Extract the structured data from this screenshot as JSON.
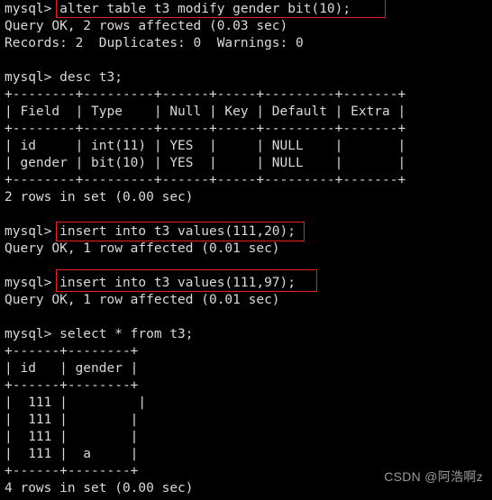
{
  "terminal": {
    "prompt": "mysql>",
    "background_color": "#000000",
    "text_color": "#d9d9d9",
    "highlight_color": "#e8201f",
    "lines": [
      "mysql> alter table t3 modify gender bit(10);",
      "Query OK, 2 rows affected (0.03 sec)",
      "Records: 2  Duplicates: 0  Warnings: 0",
      "",
      "mysql> desc t3;",
      "+--------+---------+------+-----+---------+-------+",
      "| Field  | Type    | Null | Key | Default | Extra |",
      "+--------+---------+------+-----+---------+-------+",
      "| id     | int(11) | YES  |     | NULL    |       |",
      "| gender | bit(10) | YES  |     | NULL    |       |",
      "+--------+---------+------+-----+---------+-------+",
      "2 rows in set (0.00 sec)",
      "",
      "mysql> insert into t3 values(111,20);",
      "Query OK, 1 row affected (0.01 sec)",
      "",
      "mysql> insert into t3 values(111,97);",
      "Query OK, 1 row affected (0.01 sec)",
      "",
      "mysql> select * from t3;",
      "+------+--------+",
      "| id   | gender |",
      "+------+--------+",
      "|  111 |         |",
      "|  111 |        |",
      "|  111 |        |",
      "|  111 |  a     |",
      "+------+--------+",
      "4 rows in set (0.00 sec)"
    ],
    "commands": {
      "alter": "alter table t3 modify gender bit(10);",
      "desc": "desc t3;",
      "insert_1": "insert into t3 values(111,20);",
      "insert_2": "insert into t3 values(111,97);",
      "select": "select * from t3;"
    },
    "results": {
      "alter_status": "Query OK, 2 rows affected (0.03 sec)",
      "alter_records": "Records: 2  Duplicates: 0  Warnings: 0",
      "desc_rows_count": "2 rows in set (0.00 sec)",
      "insert_1_status": "Query OK, 1 row affected (0.01 sec)",
      "insert_2_status": "Query OK, 1 row affected (0.01 sec)",
      "select_rows_count": "4 rows in set (0.00 sec)"
    },
    "desc_table": {
      "headers": [
        "Field",
        "Type",
        "Null",
        "Key",
        "Default",
        "Extra"
      ],
      "rows": [
        [
          "id",
          "int(11)",
          "YES",
          "",
          "NULL",
          ""
        ],
        [
          "gender",
          "bit(10)",
          "YES",
          "",
          "NULL",
          ""
        ]
      ]
    },
    "select_table": {
      "headers": [
        "id",
        "gender"
      ],
      "rows": [
        [
          "111",
          ""
        ],
        [
          "111",
          ""
        ],
        [
          "111",
          ""
        ],
        [
          "111",
          "a"
        ]
      ]
    },
    "highlights": [
      {
        "name": "alter-statement-highlight",
        "label": "alter table t3 modify gender bit(10);"
      },
      {
        "name": "insert-20-highlight",
        "label": "insert into t3 values(111,20);"
      },
      {
        "name": "insert-97-highlight",
        "label": "insert into t3 values(111,97);"
      }
    ]
  },
  "watermark": {
    "text": "CSDN @阿浩啊z"
  }
}
